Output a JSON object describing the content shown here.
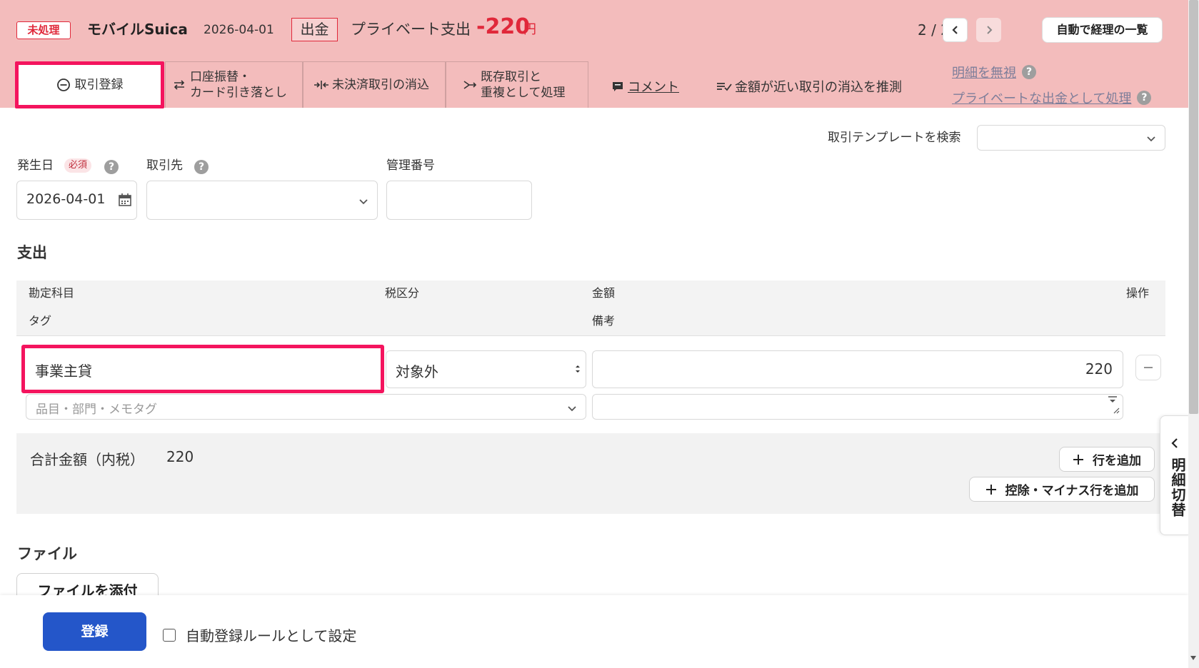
{
  "header": {
    "status_badge": "未処理",
    "account_name": "モバイルSuica",
    "date": "2026-04-01",
    "direction": "出金",
    "description": "プライベート支出",
    "amount": "-220",
    "amount_unit": "円",
    "pager": "2 / 2",
    "list_button": "自動で経理の一覧"
  },
  "tabs": [
    {
      "label": "取引登録",
      "icon": "minus-circle-icon"
    },
    {
      "label": "口座振替・\nカード引き落とし",
      "icon": "transfer-icon"
    },
    {
      "label": "未決済取引の消込",
      "icon": "settle-icon"
    },
    {
      "label": "既存取引と\n重複として処理",
      "icon": "merge-icon"
    }
  ],
  "actions": {
    "comment": "コメント",
    "guess": "金額が近い取引の消込を推測",
    "ignore": "明細を無視",
    "private": "プライベートな出金として処理"
  },
  "template_search": {
    "label": "取引テンプレートを検索",
    "value": ""
  },
  "form": {
    "date_label": "発生日",
    "required": "必須",
    "date_value": "2026-04-01",
    "partner_label": "取引先",
    "partner_value": "",
    "mgmt_label": "管理番号",
    "mgmt_value": ""
  },
  "expense": {
    "title": "支出",
    "headers": {
      "account": "勘定科目",
      "tax": "税区分",
      "amount": "金額",
      "ops": "操作",
      "tag": "タグ",
      "note": "備考"
    },
    "row": {
      "account": "事業主貸",
      "tax": "対象外",
      "amount": "220",
      "tag_placeholder": "品目・部門・メモタグ",
      "note": ""
    },
    "total_label": "合計金額（内税）",
    "total_value": "220",
    "add_row": "行を追加",
    "add_minus_row": "控除・マイナス行を追加"
  },
  "file": {
    "title": "ファイル",
    "attach": "ファイルを添付"
  },
  "footer": {
    "submit": "登録",
    "auto_rule": "自動登録ルールとして設定"
  },
  "side_tab": "明細切替",
  "colors": {
    "accent": "#2456c9",
    "header_bg": "#f3bcbc",
    "alert": "#e0283a",
    "highlight": "#f4145e"
  }
}
